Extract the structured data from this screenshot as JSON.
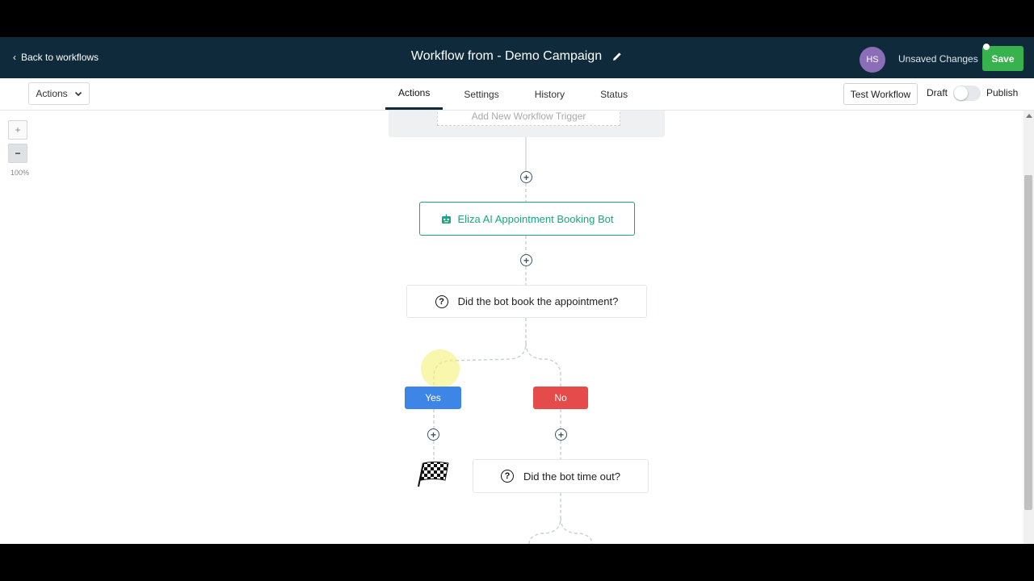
{
  "header": {
    "back_label": "Back to workflows",
    "title": "Workflow from - Demo Campaign",
    "avatar_initials": "HS",
    "unsaved_label": "Unsaved Changes",
    "save_label": "Save"
  },
  "subbar": {
    "actions_label": "Actions",
    "tabs": [
      {
        "label": "Actions",
        "active": true
      },
      {
        "label": "Settings",
        "active": false
      },
      {
        "label": "History",
        "active": false
      },
      {
        "label": "Status",
        "active": false
      }
    ],
    "test_label": "Test Workflow",
    "draft_label": "Draft",
    "publish_label": "Publish",
    "published": false
  },
  "zoom": {
    "plus": "+",
    "minus": "−",
    "level": "100%"
  },
  "workflow": {
    "trigger_label": "Add New Workflow Trigger",
    "bot_label": "Eliza AI Appointment Booking Bot",
    "condition1_label": "Did the bot book the appointment?",
    "yes_label": "Yes",
    "no_label": "No",
    "condition2_label": "Did the bot time out?",
    "question_mark": "?"
  },
  "colors": {
    "header_bg": "#0f2a3b",
    "save_green": "#37b24d",
    "bot_teal": "#1aa586",
    "yes_blue": "#3d86e8",
    "no_red": "#e54b4b",
    "avatar_purple": "#8b6db8"
  }
}
